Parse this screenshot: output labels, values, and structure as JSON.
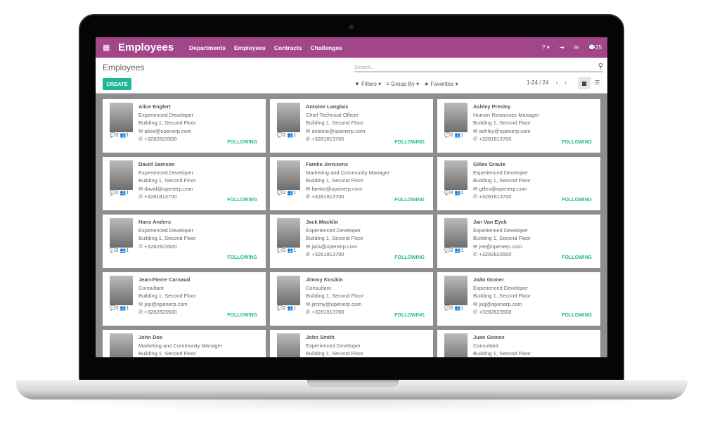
{
  "app": {
    "title": "Employees",
    "menu": [
      "Departments",
      "Employees",
      "Contracts",
      "Challenges"
    ],
    "right": {
      "help": "? ▾",
      "logout": "⇥",
      "mail": "✉",
      "chat_count": "25"
    },
    "accent": "#a24689",
    "button_color": "#21b799"
  },
  "control": {
    "title": "Employees",
    "create": "CREATE",
    "search_placeholder": "Search...",
    "filters": "Filters",
    "group_by": "Group By",
    "favorites": "Favorites",
    "pager": "1-24 / 24"
  },
  "employees": [
    {
      "name": "Alice Englert",
      "job": "Experienced Developer",
      "office": "Building 1, Second Floor",
      "email": "alice@openerp.com",
      "phone": "+3282823500",
      "messages": "2",
      "followers": "1",
      "status": "FOLLOWING"
    },
    {
      "name": "Antoine Langlais",
      "job": "Chief Technical Officer",
      "office": "Building 1, Second Floor",
      "email": "antoine@openerp.com",
      "phone": "+3281813700",
      "messages": "2",
      "followers": "1",
      "status": "FOLLOWING"
    },
    {
      "name": "Ashley Presley",
      "job": "Human Resources Manager",
      "office": "Building 1, Second Floor",
      "email": "ashley@openerp.com",
      "phone": "+3281813700",
      "messages": "2",
      "followers": "1",
      "status": "FOLLOWING"
    },
    {
      "name": "David Samson",
      "job": "Experienced Developer",
      "office": "Building 1, Second Floor",
      "email": "david@openerp.com",
      "phone": "+3281813700",
      "messages": "2",
      "followers": "1",
      "status": "FOLLOWING"
    },
    {
      "name": "Famke Jenssens",
      "job": "Marketing and Community Manager",
      "office": "Building 1, Second Floor",
      "email": "famke@openerp.com",
      "phone": "+3281813700",
      "messages": "2",
      "followers": "1",
      "status": "FOLLOWING"
    },
    {
      "name": "Gilles Gravie",
      "job": "Experienced Developer",
      "office": "Building 1, Second Floor",
      "email": "gilles@openerp.com",
      "phone": "+3281813700",
      "messages": "4",
      "followers": "2",
      "status": "FOLLOWING"
    },
    {
      "name": "Hans Anders",
      "job": "Experienced Developer",
      "office": "Building 1, Second Floor",
      "email": "",
      "phone": "+3282823500",
      "messages": "2",
      "followers": "1",
      "status": "FOLLOWING"
    },
    {
      "name": "Jack Macklin",
      "job": "Experienced Developer",
      "office": "Building 1, Second Floor",
      "email": "jack@openerp.com",
      "phone": "+3281813700",
      "messages": "2",
      "followers": "1",
      "status": "FOLLOWING"
    },
    {
      "name": "Jan Van Eyck",
      "job": "Experienced Developer",
      "office": "Building 1, Second Floor",
      "email": "jve@openerp.com",
      "phone": "+3282823500",
      "messages": "2",
      "followers": "1",
      "status": "FOLLOWING"
    },
    {
      "name": "Jean-Pierre Carnaud",
      "job": "Consultant",
      "office": "Building 1, Second Floor",
      "email": "jep@openerp.com",
      "phone": "+3282823500",
      "messages": "2",
      "followers": "1",
      "status": "FOLLOWING"
    },
    {
      "name": "Jimmy Kosikin",
      "job": "Consultant",
      "office": "Building 1, Second Floor",
      "email": "jimmy@openerp.com",
      "phone": "+3281813700",
      "messages": "2",
      "followers": "1",
      "status": "FOLLOWING"
    },
    {
      "name": "João Gomer",
      "job": "Experienced Developer",
      "office": "Building 1, Second Floor",
      "email": "jog@openerp.com",
      "phone": "+3282823500",
      "messages": "2",
      "followers": "1",
      "status": "FOLLOWING"
    },
    {
      "name": "John Doe",
      "job": "Marketing and Community Manager",
      "office": "Building 1, Second Floor"
    },
    {
      "name": "John Smith",
      "job": "Experienced Developer",
      "office": "Building 1, Second Floor"
    },
    {
      "name": "Juan Gomez",
      "job": "Consultant",
      "office": "Building 1, Second Floor"
    }
  ]
}
